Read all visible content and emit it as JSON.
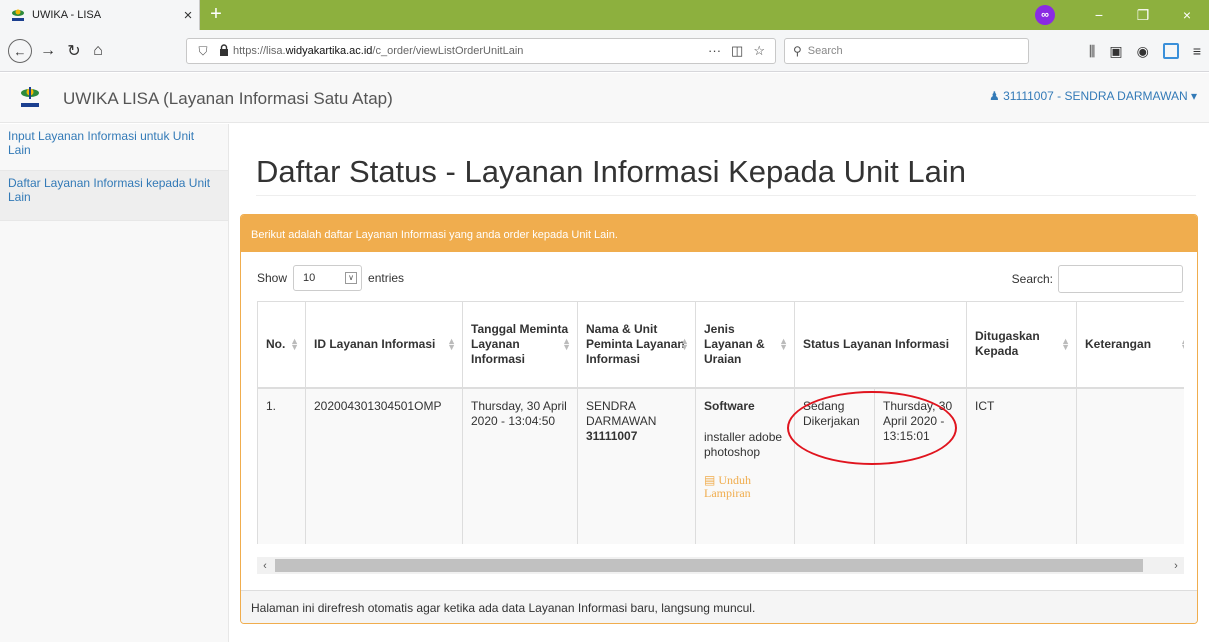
{
  "browser": {
    "tab_title": "UWIKA - LISA",
    "tab_close": "×",
    "new_tab": "+",
    "url_prefix": "https://lisa.",
    "url_domain": "widyakartika.ac.id",
    "url_path": "/c_order/viewListOrderUnitLain",
    "search_placeholder": "Search",
    "window_minimize": "−",
    "window_restore": "❐",
    "window_close": "×"
  },
  "app": {
    "title": "UWIKA LISA (Layanan Informasi Satu Atap)",
    "user": "31111007 - SENDRA DARMAWAN"
  },
  "sidebar": {
    "items": [
      {
        "label": "Input Layanan Informasi untuk Unit Lain"
      },
      {
        "label": "Daftar Layanan Informasi kepada Unit Lain"
      }
    ]
  },
  "main": {
    "heading": "Daftar Status - Layanan Informasi Kepada Unit Lain",
    "panel_heading": "Berikut adalah daftar Layanan Informasi yang anda order kepada Unit Lain.",
    "show_label": "Show",
    "entries_value": "10",
    "entries_label": "entries",
    "search_label": "Search:",
    "footer_note": "Halaman ini direfresh otomatis agar ketika ada data Layanan Informasi baru, langsung muncul."
  },
  "table": {
    "headers": [
      "No.",
      "ID Layanan Informasi",
      "Tanggal Meminta Layanan Informasi",
      "Nama & Unit Peminta Layanan Informasi",
      "Jenis Layanan & Uraian",
      "Status Layanan Informasi",
      "Ditugaskan Kepada",
      "Keterangan"
    ],
    "rows": [
      {
        "no": "1.",
        "id": "202004301304501OMP",
        "tanggal": "Thursday, 30 April 2020 - 13:04:50",
        "peminta_nama": "SENDRA DARMAWAN",
        "peminta_id": "31111007",
        "jenis": "Software",
        "uraian": "installer adobe photoshop",
        "lampiran": "Unduh Lampiran",
        "status": "Sedang Dikerjakan",
        "status_waktu": "Thursday, 30 April 2020 - 13:15:01",
        "ditugaskan": "ICT",
        "keterangan": ""
      }
    ]
  }
}
